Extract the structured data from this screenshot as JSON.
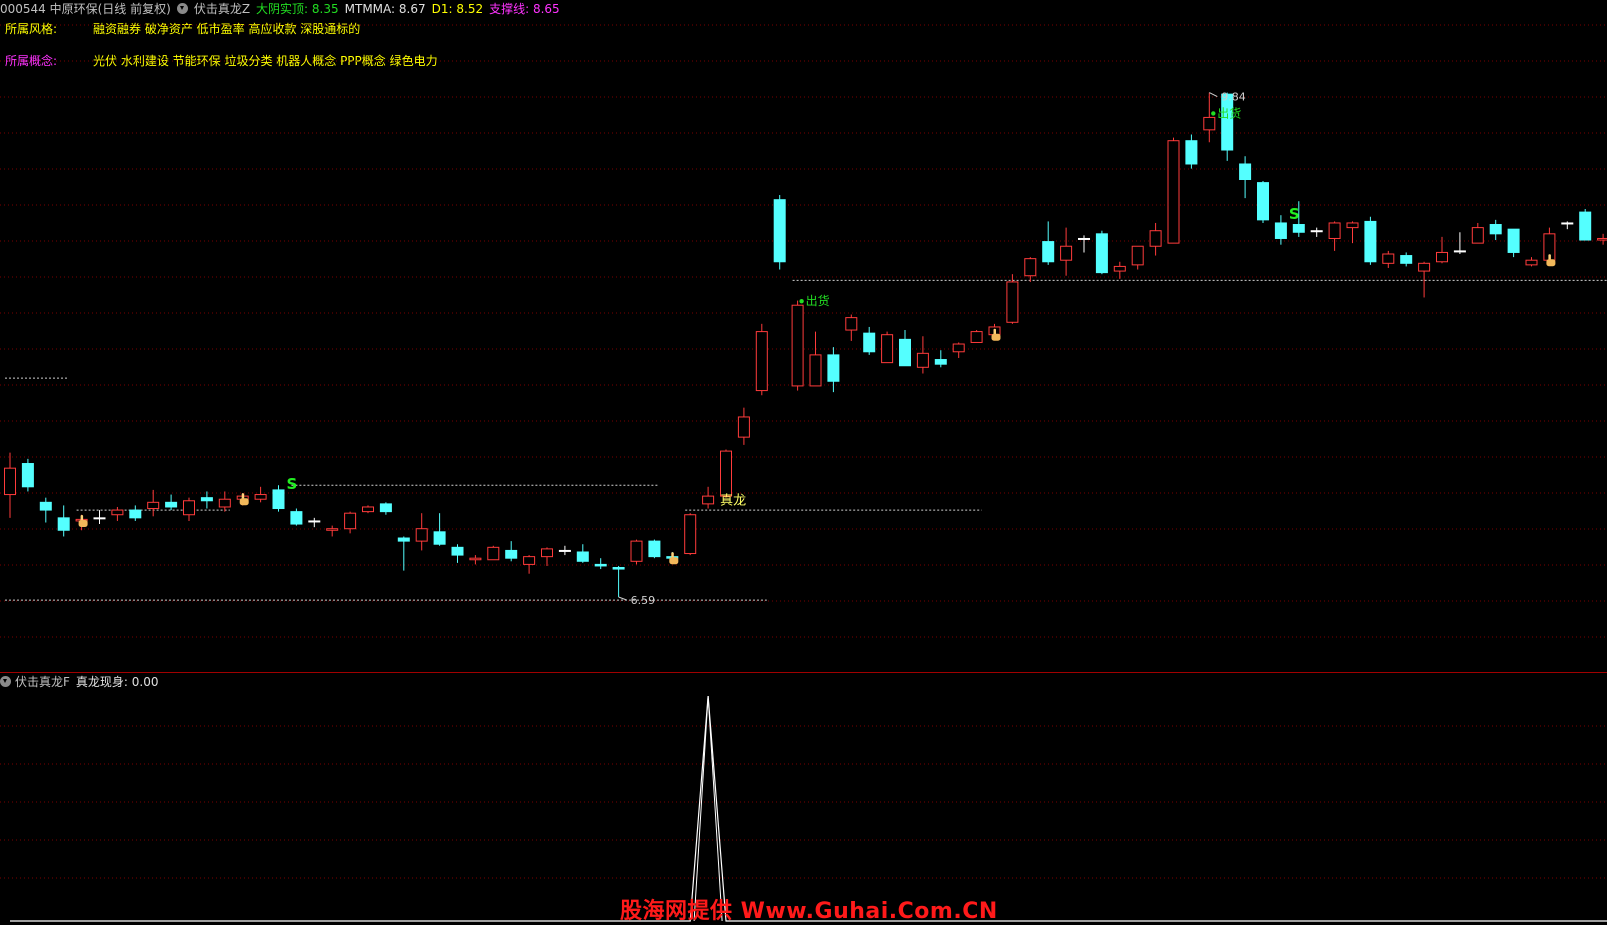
{
  "header": {
    "code_name": "000544 中原环保(日线 前复权)",
    "indicator": "伏击真龙Z",
    "items": [
      {
        "label": "大阴实顶:",
        "value": "8.35",
        "color": "#22dd22"
      },
      {
        "label": "MTMMA:",
        "value": "8.67",
        "color": "#e0e0e0"
      },
      {
        "label": "D1:",
        "value": "8.52",
        "color": "#ffff00"
      },
      {
        "label": "支撑线:",
        "value": "8.65",
        "color": "#ff33ff"
      }
    ]
  },
  "info": {
    "style_label": "所属风格:",
    "style_value": "融资融券 破净资产 低市盈率 高应收款 深股通标的",
    "concept_label": "所属概念:",
    "concept_value": "光伏 水利建设 节能环保 垃圾分类 机器人概念 PPP概念 绿色电力"
  },
  "chart_data": [
    {
      "type": "candlestick",
      "title": "伏击真龙Z",
      "ylim": [
        6.3,
        10.05
      ],
      "grid": true,
      "up_color": "#ff3b3b",
      "down_color": "#54ffff",
      "doji_color": "#ffffff",
      "candles": [
        [
          7.25,
          7.42,
          7.1,
          7.52
        ],
        [
          7.45,
          7.3,
          7.27,
          7.48
        ],
        [
          7.2,
          7.15,
          7.07,
          7.23
        ],
        [
          7.1,
          7.02,
          6.98,
          7.18
        ],
        [
          7.08,
          7.09,
          7.02,
          7.12
        ],
        [
          7.1,
          7.1,
          7.06,
          7.15
        ],
        [
          7.12,
          7.15,
          7.08,
          7.17
        ],
        [
          7.15,
          7.1,
          7.08,
          7.18
        ],
        [
          7.16,
          7.2,
          7.11,
          7.28
        ],
        [
          7.2,
          7.17,
          7.15,
          7.25
        ],
        [
          7.12,
          7.21,
          7.08,
          7.23
        ],
        [
          7.23,
          7.21,
          7.16,
          7.27
        ],
        [
          7.17,
          7.22,
          7.14,
          7.27
        ],
        [
          7.22,
          7.24,
          7.18,
          7.26
        ],
        [
          7.22,
          7.25,
          7.2,
          7.3
        ],
        [
          7.28,
          7.16,
          7.14,
          7.31
        ],
        [
          7.14,
          7.06,
          7.05,
          7.16
        ],
        [
          7.08,
          7.08,
          7.04,
          7.1
        ],
        [
          7.02,
          7.03,
          6.98,
          7.05
        ],
        [
          7.03,
          7.13,
          7.0,
          7.14
        ],
        [
          7.14,
          7.17,
          7.13,
          7.18
        ],
        [
          7.19,
          7.14,
          7.12,
          7.2
        ],
        [
          6.97,
          6.95,
          6.76,
          6.98
        ],
        [
          6.95,
          7.03,
          6.89,
          7.13
        ],
        [
          7.01,
          6.93,
          6.92,
          7.13
        ],
        [
          6.91,
          6.86,
          6.81,
          6.93
        ],
        [
          6.83,
          6.84,
          6.8,
          6.86
        ],
        [
          6.83,
          6.91,
          6.83,
          6.92
        ],
        [
          6.89,
          6.84,
          6.82,
          6.95
        ],
        [
          6.8,
          6.85,
          6.74,
          6.86
        ],
        [
          6.85,
          6.9,
          6.79,
          6.91
        ],
        [
          6.89,
          6.89,
          6.86,
          6.92
        ],
        [
          6.88,
          6.82,
          6.81,
          6.93
        ],
        [
          6.8,
          6.79,
          6.77,
          6.84
        ],
        [
          6.78,
          6.77,
          6.59,
          6.79
        ],
        [
          6.82,
          6.95,
          6.8,
          6.96
        ],
        [
          6.95,
          6.85,
          6.84,
          6.96
        ],
        [
          6.85,
          6.84,
          6.82,
          6.88
        ],
        [
          6.87,
          7.12,
          6.86,
          7.13
        ],
        [
          7.19,
          7.24,
          7.16,
          7.3
        ],
        [
          7.24,
          7.53,
          7.23,
          7.54
        ],
        [
          7.62,
          7.75,
          7.57,
          7.81
        ],
        [
          7.92,
          8.3,
          7.89,
          8.35
        ],
        [
          9.15,
          8.75,
          8.7,
          9.18
        ],
        [
          7.95,
          8.47,
          7.92,
          8.5
        ],
        [
          7.95,
          8.15,
          7.95,
          8.3
        ],
        [
          8.15,
          7.98,
          7.91,
          8.2
        ],
        [
          8.31,
          8.39,
          8.24,
          8.41
        ],
        [
          8.29,
          8.17,
          8.15,
          8.33
        ],
        [
          8.1,
          8.28,
          8.1,
          8.3
        ],
        [
          8.25,
          8.08,
          8.08,
          8.31
        ],
        [
          8.07,
          8.16,
          8.03,
          8.27
        ],
        [
          8.12,
          8.09,
          8.07,
          8.18
        ],
        [
          8.17,
          8.22,
          8.13,
          8.23
        ],
        [
          8.23,
          8.3,
          8.23,
          8.31
        ],
        [
          8.28,
          8.33,
          8.25,
          8.35
        ],
        [
          8.36,
          8.62,
          8.35,
          8.67
        ],
        [
          8.66,
          8.77,
          8.62,
          8.78
        ],
        [
          8.88,
          8.75,
          8.73,
          9.01
        ],
        [
          8.76,
          8.85,
          8.66,
          8.97
        ],
        [
          8.9,
          8.9,
          8.81,
          8.92
        ],
        [
          8.93,
          8.68,
          8.67,
          8.95
        ],
        [
          8.69,
          8.72,
          8.64,
          8.75
        ],
        [
          8.73,
          8.85,
          8.7,
          8.85
        ],
        [
          8.85,
          8.95,
          8.79,
          9.0
        ],
        [
          8.87,
          9.53,
          8.87,
          9.55
        ],
        [
          9.53,
          9.38,
          9.35,
          9.57
        ],
        [
          9.6,
          9.68,
          9.52,
          9.84
        ],
        [
          9.83,
          9.47,
          9.4,
          9.84
        ],
        [
          9.38,
          9.28,
          9.16,
          9.43
        ],
        [
          9.26,
          9.02,
          9.0,
          9.27
        ],
        [
          9.0,
          8.9,
          8.86,
          9.05
        ],
        [
          8.99,
          8.94,
          8.91,
          9.14
        ],
        [
          8.95,
          8.95,
          8.91,
          8.97
        ],
        [
          8.9,
          9.0,
          8.82,
          9.01
        ],
        [
          8.97,
          9.0,
          8.87,
          9.01
        ],
        [
          9.01,
          8.75,
          8.73,
          9.04
        ],
        [
          8.74,
          8.8,
          8.71,
          8.82
        ],
        [
          8.79,
          8.74,
          8.72,
          8.81
        ],
        [
          8.69,
          8.74,
          8.52,
          8.75
        ],
        [
          8.75,
          8.81,
          8.74,
          8.91
        ],
        [
          8.82,
          8.82,
          8.8,
          8.94
        ],
        [
          8.87,
          8.97,
          8.87,
          9.0
        ],
        [
          8.99,
          8.93,
          8.89,
          9.02
        ],
        [
          8.96,
          8.81,
          8.78,
          8.96
        ],
        [
          8.73,
          8.76,
          8.72,
          8.78
        ],
        [
          8.76,
          8.93,
          8.75,
          8.97
        ],
        [
          9.0,
          9.0,
          8.96,
          9.01
        ],
        [
          9.07,
          8.89,
          8.89,
          9.09
        ],
        [
          8.89,
          8.9,
          8.86,
          8.93
        ],
        [
          8.97,
          8.99,
          8.96,
          9.0
        ],
        [
          8.94,
          8.88,
          8.88,
          8.96
        ]
      ],
      "annotations": {
        "high_label": "9.84",
        "low_label": "6.59",
        "signal_labels": [
          "出货",
          "出货"
        ],
        "s_labels": [
          "S",
          "S"
        ],
        "dragon_label": "真龙"
      },
      "markers": [
        {
          "type": "chuhuo",
          "index": 44
        },
        {
          "type": "chuhuo",
          "index": 67
        },
        {
          "type": "S",
          "index": 15
        },
        {
          "type": "S",
          "index": 71
        },
        {
          "type": "zhenlong",
          "index": 39
        },
        {
          "type": "hand",
          "index": 4
        },
        {
          "type": "hand",
          "index": 13
        },
        {
          "type": "hand",
          "index": 37
        },
        {
          "type": "hand",
          "index": 55
        },
        {
          "type": "hand",
          "index": 86
        }
      ],
      "support_lines": [
        {
          "from": 0,
          "to": 3,
          "y": 8.0
        },
        {
          "from": 4,
          "to": 12,
          "y": 7.15
        },
        {
          "from": 16,
          "to": 36,
          "y": 7.31
        },
        {
          "from": 38,
          "to": 54,
          "y": 7.15
        },
        {
          "from": 44,
          "to": 89,
          "y": 8.63
        },
        {
          "from": 0,
          "to": 42,
          "y": 6.57
        }
      ]
    },
    {
      "type": "line",
      "title": "伏击真龙F",
      "series": [
        {
          "name": "真龙现身",
          "latest": "0.00"
        }
      ],
      "ylim": [
        0,
        1
      ],
      "spike_index": 39,
      "spike_value": 1
    }
  ],
  "sub_header": {
    "indicator": "伏击真龙F",
    "label": "真龙现身:",
    "value": "0.00"
  },
  "watermark": "股海网提供 Www.Guhai.Com.CN"
}
